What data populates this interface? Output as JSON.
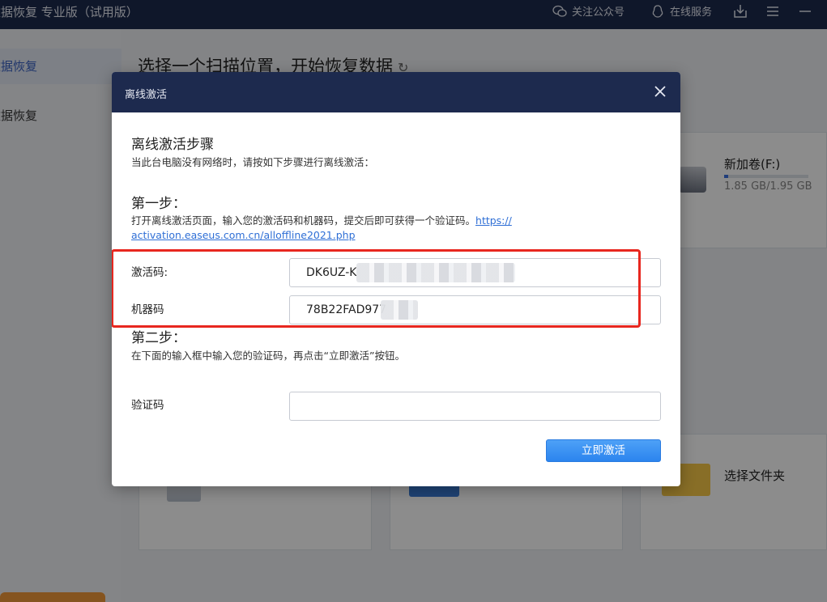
{
  "app": {
    "title": "数据恢复 专业版（试用版）",
    "toolbar": {
      "wechat_label": "关注公众号",
      "service_label": "在线服务"
    }
  },
  "sidebar": {
    "items": [
      {
        "label": "数据恢复",
        "active": true
      },
      {
        "label": "数据恢复",
        "active": false
      }
    ]
  },
  "main": {
    "heading": "选择一个扫描位置，开始恢复数据",
    "drive": {
      "label": "新加卷(F:)",
      "size": "1.85 GB/1.95 GB",
      "used_fraction": 0.05
    },
    "folder_label": "选择文件夹"
  },
  "dialog": {
    "title": "离线激活",
    "steps_title": "离线激活步骤",
    "steps_desc": "当此台电脑没有网络时，请按如下步骤进行离线激活：",
    "step1_title": "第一步：",
    "step1_desc": "打开离线激活页面，输入您的激活码和机器码，提交后即可获得一个验证码。",
    "step1_link_part1": "https://",
    "step1_link_part2": "activation.easeus.com.cn/alloffline2021.php",
    "activation_code_label": "激活码:",
    "activation_code_value": "DK6UZ-K",
    "machine_code_label": "机器码",
    "machine_code_value": "78B22FAD977",
    "step2_title": "第二步：",
    "step2_desc": "在下面的输入框中输入您的验证码，再点击“立即激活”按钮。",
    "verify_label": "验证码",
    "verify_value": "",
    "activate_button": "立即激活"
  },
  "colors": {
    "header_bg": "#1d2a4e",
    "accent": "#2b84ee",
    "highlight": "#e8271f",
    "link": "#2f6fd6"
  }
}
